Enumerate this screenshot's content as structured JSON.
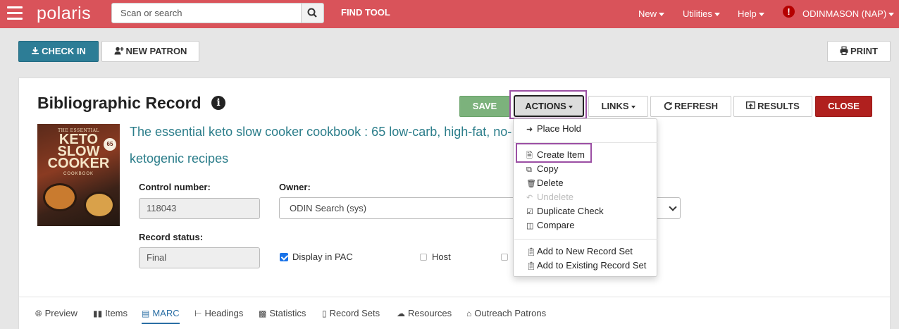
{
  "topbar": {
    "logo": "polaris",
    "search_placeholder": "Scan or search",
    "find_tool": "FIND TOOL",
    "new": "New",
    "utilities": "Utilities",
    "help": "Help",
    "user": "ODINMASON (NAP)"
  },
  "toolbar": {
    "check_in": "CHECK IN",
    "new_patron": "NEW PATRON",
    "print": "PRINT"
  },
  "record": {
    "page_title": "Bibliographic Record",
    "save": "SAVE",
    "actions": "ACTIONS",
    "links": "LINKS",
    "refresh": "REFRESH",
    "results": "RESULTS",
    "close": "CLOSE",
    "title_line1": "The essential keto slow cooker cookbook : 65 low-carb, high-fat, no-",
    "title_line2": "ketogenic recipes",
    "cover": {
      "top_text": "THE ESSENTIAL",
      "title": "KETO SLOW COOKER",
      "sub": "COOKBOOK",
      "badge": "65"
    },
    "control_number_label": "Control number:",
    "control_number": "118043",
    "owner_label": "Owner:",
    "owner_value": "ODIN Search (sys)",
    "record_status_label": "Record status:",
    "record_status": "Final",
    "display_in_pac": "Display in PAC",
    "host": "Host"
  },
  "actions_menu": {
    "place_hold": "Place Hold",
    "create_item": "Create Item",
    "copy": "Copy",
    "delete": "Delete",
    "undelete": "Undelete",
    "duplicate_check": "Duplicate Check",
    "compare": "Compare",
    "add_new_set": "Add to New Record Set",
    "add_existing_set": "Add to Existing Record Set"
  },
  "tabs": {
    "preview": "Preview",
    "items": "Items",
    "marc": "MARC",
    "headings": "Headings",
    "statistics": "Statistics",
    "record_sets": "Record Sets",
    "resources": "Resources",
    "outreach": "Outreach Patrons"
  }
}
